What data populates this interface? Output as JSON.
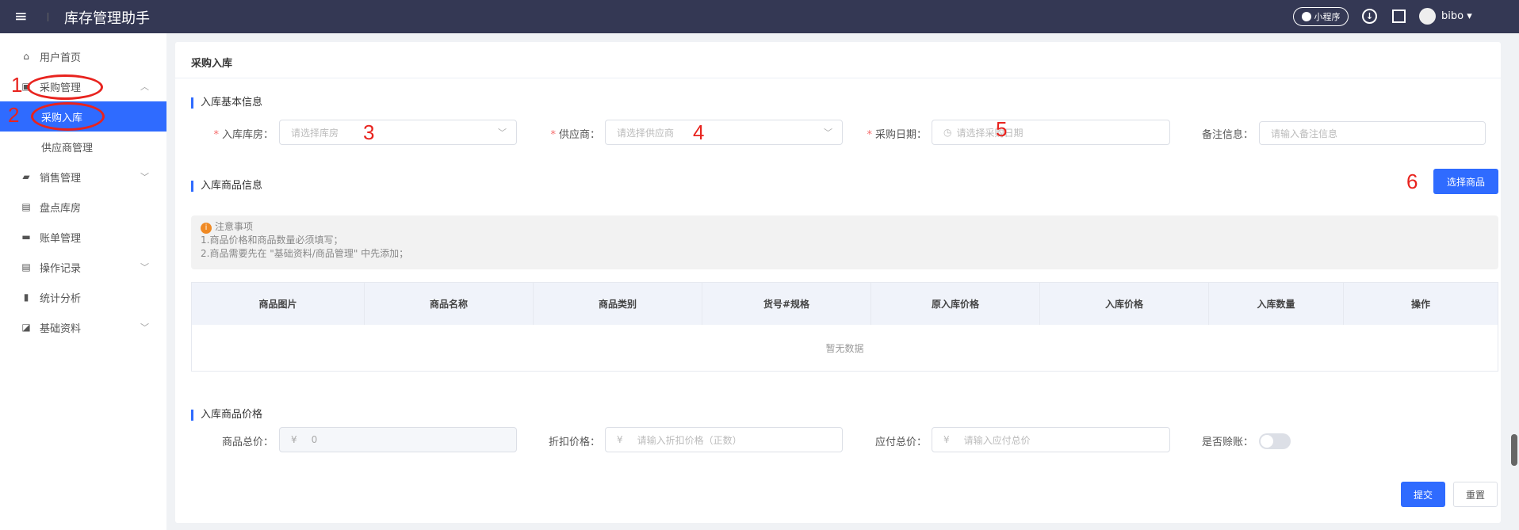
{
  "header": {
    "title": "库存管理助手",
    "mini_program": "小程序",
    "username": "bibo"
  },
  "sidebar": {
    "items": [
      {
        "label": "用户首页",
        "icon": "home-icon"
      },
      {
        "label": "采购管理",
        "icon": "bag-icon",
        "expanded": true
      },
      {
        "label": "采购入库",
        "active": true
      },
      {
        "label": "供应商管理"
      },
      {
        "label": "销售管理",
        "icon": "ticket-icon"
      },
      {
        "label": "盘点库房",
        "icon": "clipboard-icon"
      },
      {
        "label": "账单管理",
        "icon": "wallet-icon"
      },
      {
        "label": "操作记录",
        "icon": "record-icon"
      },
      {
        "label": "统计分析",
        "icon": "bar-chart-icon"
      },
      {
        "label": "基础资料",
        "icon": "line-chart-icon"
      }
    ]
  },
  "page": {
    "title": "采购入库"
  },
  "basic": {
    "title": "入库基本信息",
    "warehouse_label": "入库库房：",
    "warehouse_placeholder": "请选择库房",
    "supplier_label": "供应商：",
    "supplier_placeholder": "请选择供应商",
    "date_label": "采购日期：",
    "date_placeholder": "请选择采购日期",
    "remark_label": "备注信息：",
    "remark_placeholder": "请输入备注信息"
  },
  "goods": {
    "title": "入库商品信息",
    "select_button": "选择商品",
    "notice_title": "注意事项",
    "notice_lines": [
      "1.商品价格和商品数量必须填写；",
      "2.商品需要先在 \"基础资料/商品管理\" 中先添加；"
    ],
    "columns": [
      "商品图片",
      "商品名称",
      "商品类别",
      "货号#规格",
      "原入库价格",
      "入库价格",
      "入库数量",
      "操作"
    ],
    "empty": "暂无数据"
  },
  "price": {
    "title": "入库商品价格",
    "total_label": "商品总价：",
    "total_value": "0",
    "currency": "¥",
    "discount_label": "折扣价格：",
    "discount_placeholder": "请输入折扣价格（正数）",
    "payable_label": "应付总价：",
    "payable_placeholder": "请输入应付总价",
    "credit_label": "是否赊账：",
    "credit_on": false
  },
  "actions": {
    "submit": "提交",
    "reset": "重置"
  },
  "annotations": [
    "1",
    "2",
    "3",
    "4",
    "5",
    "6"
  ],
  "colors": {
    "header": "#343854",
    "primary": "#2f6bff",
    "annotation": "#e8231e"
  }
}
